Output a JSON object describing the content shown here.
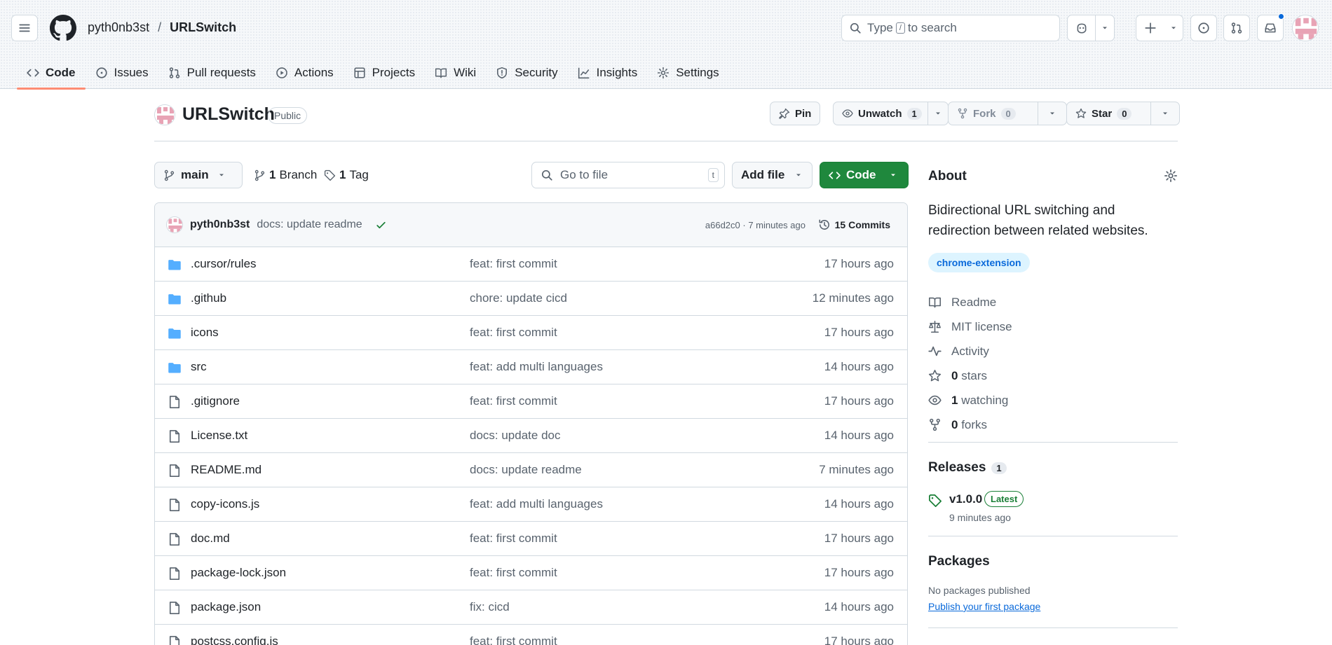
{
  "header": {
    "owner": "pyth0nb3st",
    "separator": "/",
    "repo": "URLSwitch",
    "search_prefix": "Type",
    "search_key": "/",
    "search_suffix": "to search"
  },
  "nav": {
    "tabs": [
      {
        "label": "Code",
        "icon": "code-icon",
        "active": true
      },
      {
        "label": "Issues",
        "icon": "issue-icon"
      },
      {
        "label": "Pull requests",
        "icon": "pull-request-icon"
      },
      {
        "label": "Actions",
        "icon": "play-icon"
      },
      {
        "label": "Projects",
        "icon": "table-icon"
      },
      {
        "label": "Wiki",
        "icon": "book-icon"
      },
      {
        "label": "Security",
        "icon": "shield-icon"
      },
      {
        "label": "Insights",
        "icon": "graph-icon"
      },
      {
        "label": "Settings",
        "icon": "gear-icon"
      }
    ]
  },
  "repo_header": {
    "name": "URLSwitch",
    "visibility": "Public",
    "pin_label": "Pin",
    "unwatch_label": "Unwatch",
    "watch_count": "1",
    "fork_label": "Fork",
    "fork_count": "0",
    "star_label": "Star",
    "star_count": "0"
  },
  "toolbar": {
    "branch": "main",
    "branches_count": "1",
    "branches_label": "Branch",
    "tags_count": "1",
    "tags_label": "Tag",
    "goto_placeholder": "Go to file",
    "goto_key": "t",
    "add_file_label": "Add file",
    "code_label": "Code"
  },
  "latest_commit": {
    "author": "pyth0nb3st",
    "message": "docs: update readme",
    "meta": "a66d2c0 · 7 minutes ago",
    "commits_label": "15 Commits"
  },
  "files": [
    {
      "name": ".cursor/rules",
      "type": "dir",
      "message": "feat: first commit",
      "age": "17 hours ago"
    },
    {
      "name": ".github",
      "type": "dir",
      "message": "chore: update cicd",
      "age": "12 minutes ago"
    },
    {
      "name": "icons",
      "type": "dir",
      "message": "feat: first commit",
      "age": "17 hours ago"
    },
    {
      "name": "src",
      "type": "dir",
      "message": "feat: add multi languages",
      "age": "14 hours ago"
    },
    {
      "name": ".gitignore",
      "type": "file",
      "message": "feat: first commit",
      "age": "17 hours ago"
    },
    {
      "name": "License.txt",
      "type": "file",
      "message": "docs: update doc",
      "age": "14 hours ago"
    },
    {
      "name": "README.md",
      "type": "file",
      "message": "docs: update readme",
      "age": "7 minutes ago"
    },
    {
      "name": "copy-icons.js",
      "type": "file",
      "message": "feat: add multi languages",
      "age": "14 hours ago"
    },
    {
      "name": "doc.md",
      "type": "file",
      "message": "feat: first commit",
      "age": "17 hours ago"
    },
    {
      "name": "package-lock.json",
      "type": "file",
      "message": "feat: first commit",
      "age": "17 hours ago"
    },
    {
      "name": "package.json",
      "type": "file",
      "message": "fix: cicd",
      "age": "14 hours ago"
    },
    {
      "name": "postcss.config.js",
      "type": "file",
      "message": "feat: first commit",
      "age": "17 hours ago"
    }
  ],
  "about": {
    "title": "About",
    "description": "Bidirectional URL switching and redirection between related websites.",
    "topic": "chrome-extension",
    "readme_label": "Readme",
    "license_label": "MIT license",
    "activity_label": "Activity",
    "stars_count": "0",
    "stars_label": "stars",
    "watching_count": "1",
    "watching_label": "watching",
    "forks_count": "0",
    "forks_label": "forks"
  },
  "releases": {
    "title": "Releases",
    "count": "1",
    "version": "v1.0.0",
    "latest_label": "Latest",
    "when": "9 minutes ago"
  },
  "packages": {
    "title": "Packages",
    "none_label": "No packages published",
    "publish_link": "Publish your first package"
  },
  "colors": {
    "accent": "#0969da",
    "success": "#1f883d",
    "tab_underline": "#fd8c73",
    "folder": "#54aeff"
  }
}
